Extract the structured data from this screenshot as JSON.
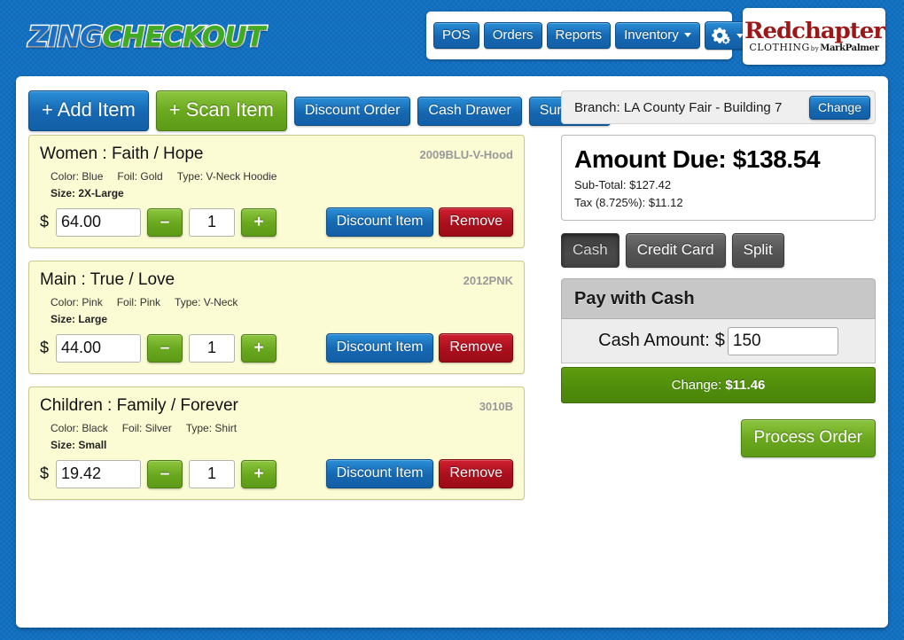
{
  "header": {
    "logo": {
      "part1": "Zing",
      "part2": "Checkout"
    },
    "nav": [
      {
        "label": "POS",
        "icon": null,
        "dropdown": false
      },
      {
        "label": "Orders",
        "icon": null,
        "dropdown": false
      },
      {
        "label": "Reports",
        "icon": null,
        "dropdown": false
      },
      {
        "label": "Inventory",
        "icon": null,
        "dropdown": true
      },
      {
        "label": "",
        "icon": "gear-icon",
        "dropdown": true
      }
    ],
    "brand": {
      "main": "Redchapter",
      "sub": "CLOTHING",
      "by": "by",
      "artist": "MarkPalmer"
    }
  },
  "toolbar": {
    "add_item": "+ Add Item",
    "scan_item": "+ Scan Item",
    "discount_order": "Discount Order",
    "cash_drawer": "Cash Drawer",
    "summary": "Summary"
  },
  "item_labels": {
    "dollar": "$",
    "minus": "–",
    "plus": "+",
    "discount_item": "Discount Item",
    "remove": "Remove"
  },
  "items": [
    {
      "title": "Women : Faith / Hope",
      "sku": "2009BLU-V-Hood",
      "color": "Color: Blue",
      "foil": "Foil: Gold",
      "type": "Type: V-Neck Hoodie",
      "size": "Size: 2X-Large",
      "price": "64.00",
      "qty": "1"
    },
    {
      "title": "Main : True / Love",
      "sku": "2012PNK",
      "color": "Color: Pink",
      "foil": "Foil: Pink",
      "type": "Type: V-Neck",
      "size": "Size: Large",
      "price": "44.00",
      "qty": "1"
    },
    {
      "title": "Children : Family / Forever",
      "sku": "3010B",
      "color": "Color: Black",
      "foil": "Foil: Silver",
      "type": "Type: Shirt",
      "size": "Size: Small",
      "price": "19.42",
      "qty": "1"
    }
  ],
  "branch": {
    "label": "Branch:  LA County Fair - Building 7",
    "change_button": "Change"
  },
  "totals": {
    "amount_due": "Amount Due: $138.54",
    "subtotal": "Sub-Total: $127.42",
    "tax": "Tax (8.725%): $11.12"
  },
  "payment": {
    "tabs": [
      {
        "label": "Cash",
        "active": true
      },
      {
        "label": "Credit Card",
        "active": false
      },
      {
        "label": "Split",
        "active": false
      }
    ],
    "panel_title": "Pay with Cash",
    "cash_amount_label": "Cash Amount:",
    "cash_dollar": "$",
    "cash_amount_value": "150",
    "change_label": "Change:",
    "change_value": "$11.46",
    "process_order": "Process Order"
  },
  "colors": {
    "page_blue": "#0f6dbd",
    "button_blue": "#1668b2",
    "button_green": "#6aa81e",
    "button_red": "#ab0f1c",
    "item_card_bg": "#fbfbd4",
    "change_bar_green": "#4f8c0b",
    "brand_red": "#9c1818"
  }
}
